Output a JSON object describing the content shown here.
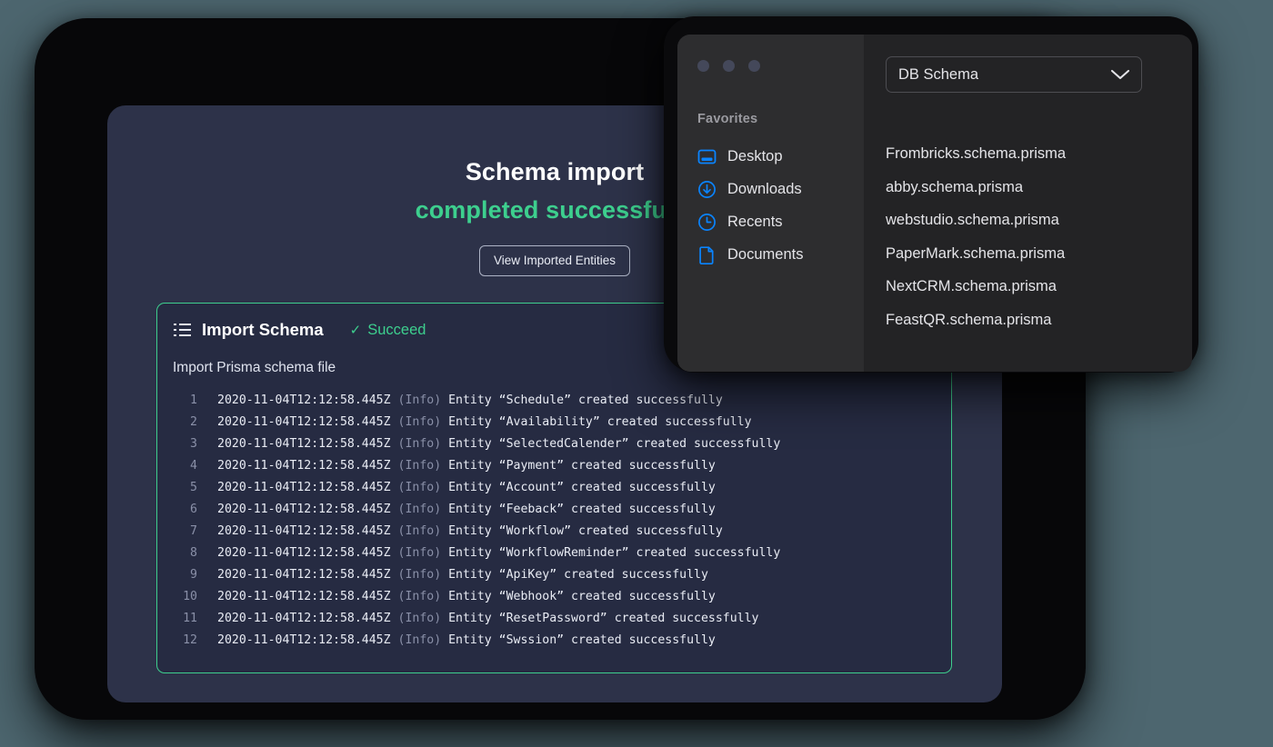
{
  "app": {
    "hero": {
      "title": "Schema import",
      "subtitle": "completed successfully",
      "button_label": "View Imported Entities"
    },
    "import_panel": {
      "icon": "list-icon",
      "title": "Import Schema",
      "status_icon": "check-icon",
      "status_label": "Succeed",
      "subtitle": "Import Prisma schema file",
      "log_lines": [
        {
          "n": "1",
          "timestamp": "2020-11-04T12:12:58.445Z",
          "level": "(Info)",
          "message": "Entity “Schedule” created successfully"
        },
        {
          "n": "2",
          "timestamp": "2020-11-04T12:12:58.445Z",
          "level": "(Info)",
          "message": "Entity “Availability” created successfully"
        },
        {
          "n": "3",
          "timestamp": "2020-11-04T12:12:58.445Z",
          "level": "(Info)",
          "message": "Entity “SelectedCalender” created successfully"
        },
        {
          "n": "4",
          "timestamp": "2020-11-04T12:12:58.445Z",
          "level": "(Info)",
          "message": "Entity “Payment” created successfully"
        },
        {
          "n": "5",
          "timestamp": "2020-11-04T12:12:58.445Z",
          "level": "(Info)",
          "message": "Entity “Account” created successfully"
        },
        {
          "n": "6",
          "timestamp": "2020-11-04T12:12:58.445Z",
          "level": "(Info)",
          "message": "Entity “Feeback” created successfully"
        },
        {
          "n": "7",
          "timestamp": "2020-11-04T12:12:58.445Z",
          "level": "(Info)",
          "message": "Entity “Workflow” created successfully"
        },
        {
          "n": "8",
          "timestamp": "2020-11-04T12:12:58.445Z",
          "level": "(Info)",
          "message": "Entity “WorkflowReminder” created successfully"
        },
        {
          "n": "9",
          "timestamp": "2020-11-04T12:12:58.445Z",
          "level": "(Info)",
          "message": "Entity “ApiKey” created successfully"
        },
        {
          "n": "10",
          "timestamp": "2020-11-04T12:12:58.445Z",
          "level": "(Info)",
          "message": "Entity “Webhook” created successfully"
        },
        {
          "n": "11",
          "timestamp": "2020-11-04T12:12:58.445Z",
          "level": "(Info)",
          "message": "Entity “ResetPassword” created successfully"
        },
        {
          "n": "12",
          "timestamp": "2020-11-04T12:12:58.445Z",
          "level": "(Info)",
          "message": "Entity “Swssion” created successfully"
        }
      ]
    }
  },
  "file_picker": {
    "window_dots": [
      "dot-1",
      "dot-2",
      "dot-3"
    ],
    "sidebar": {
      "section_label": "Favorites",
      "items": [
        {
          "label": "Desktop",
          "icon": "monitor-icon"
        },
        {
          "label": "Downloads",
          "icon": "download-circle-icon"
        },
        {
          "label": "Recents",
          "icon": "clock-icon"
        },
        {
          "label": "Documents",
          "icon": "document-icon"
        }
      ]
    },
    "location_select": {
      "value": "DB Schema",
      "icon": "chevron-down-icon"
    },
    "files": [
      "Frombricks.schema.prisma",
      "abby.schema.prisma",
      "webstudio.schema.prisma",
      "PaperMark.schema.prisma",
      "NextCRM.schema.prisma",
      "FeastQR.schema.prisma"
    ]
  },
  "colors": {
    "page_background": "#4d666f",
    "device_bezel": "#070709",
    "app_card": "#2d3249",
    "accent_green": "#3dcf8e",
    "panel_background": "#262b42",
    "finder_sidebar": "#2d2d2f",
    "finder_main": "#232325",
    "finder_icon_blue": "#0a84ff"
  }
}
